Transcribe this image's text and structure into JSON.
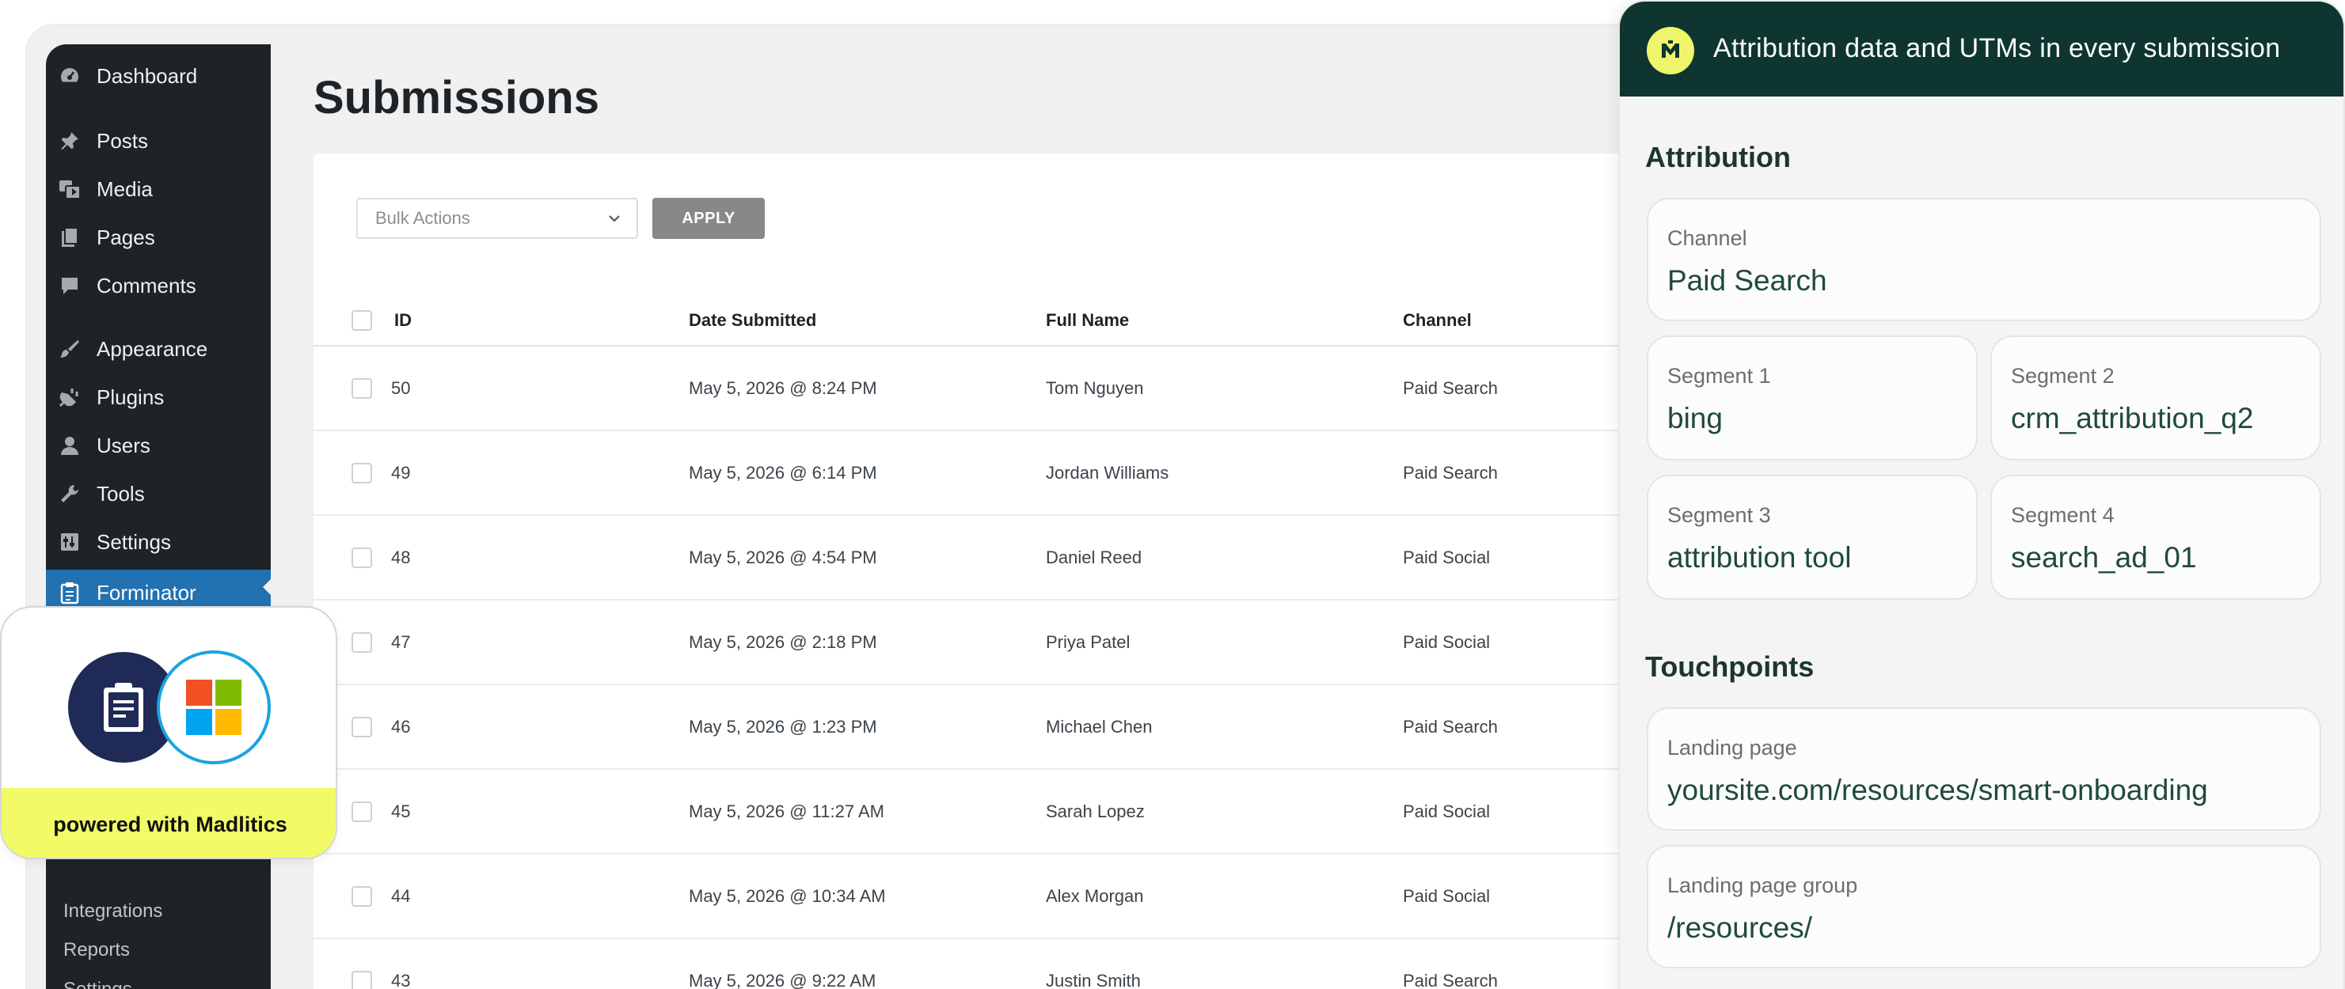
{
  "sidebar": {
    "items": [
      {
        "label": "Dashboard",
        "icon": "dashboard-icon"
      },
      {
        "label": "Posts",
        "icon": "pin-icon"
      },
      {
        "label": "Media",
        "icon": "media-icon"
      },
      {
        "label": "Pages",
        "icon": "pages-icon"
      },
      {
        "label": "Comments",
        "icon": "comment-icon"
      },
      {
        "label": "Appearance",
        "icon": "brush-icon"
      },
      {
        "label": "Plugins",
        "icon": "plug-icon"
      },
      {
        "label": "Users",
        "icon": "user-icon"
      },
      {
        "label": "Tools",
        "icon": "wrench-icon"
      },
      {
        "label": "Settings",
        "icon": "settings-icon"
      },
      {
        "label": "Forminator",
        "icon": "clipboard-icon",
        "active": true
      }
    ],
    "sub_items": [
      "Integrations",
      "Reports",
      "Settings"
    ]
  },
  "main": {
    "title": "Submissions",
    "bulk_actions_placeholder": "Bulk Actions",
    "apply_label": "APPLY",
    "columns": [
      "ID",
      "Date Submitted",
      "Full Name",
      "Channel"
    ],
    "rows": [
      {
        "id": "50",
        "date": "May 5, 2026 @ 8:24 PM",
        "name": "Tom Nguyen",
        "channel": "Paid Search"
      },
      {
        "id": "49",
        "date": "May 5, 2026 @ 6:14 PM",
        "name": "Jordan Williams",
        "channel": "Paid Search"
      },
      {
        "id": "48",
        "date": "May 5, 2026 @ 4:54 PM",
        "name": "Daniel Reed",
        "channel": "Paid Social"
      },
      {
        "id": "47",
        "date": "May 5, 2026 @ 2:18 PM",
        "name": "Priya Patel",
        "channel": "Paid Social"
      },
      {
        "id": "46",
        "date": "May 5, 2026 @ 1:23 PM",
        "name": "Michael Chen",
        "channel": "Paid Search"
      },
      {
        "id": "45",
        "date": "May 5, 2026 @ 11:27 AM",
        "name": "Sarah Lopez",
        "channel": "Paid Social"
      },
      {
        "id": "44",
        "date": "May 5, 2026 @ 10:34 AM",
        "name": "Alex Morgan",
        "channel": "Paid Social"
      },
      {
        "id": "43",
        "date": "May 5, 2026 @ 9:22 AM",
        "name": "Justin Smith",
        "channel": "Paid Search"
      }
    ]
  },
  "badge": {
    "text": "powered with Madlitics",
    "icons": [
      "forminator-icon",
      "microsoft-icon"
    ]
  },
  "panel": {
    "title": "Attribution data and UTMs in every submission",
    "attribution_heading": "Attribution",
    "channel": {
      "label": "Channel",
      "value": "Paid Search"
    },
    "segments": [
      {
        "label": "Segment 1",
        "value": "bing"
      },
      {
        "label": "Segment 2",
        "value": "crm_attribution_q2"
      },
      {
        "label": "Segment 3",
        "value": "attribution tool"
      },
      {
        "label": "Segment 4",
        "value": "search_ad_01"
      }
    ],
    "touchpoints_heading": "Touchpoints",
    "landing_page": {
      "label": "Landing page",
      "value": "yoursite.com/resources/smart-onboarding"
    },
    "landing_page_group": {
      "label": "Landing page group",
      "value": "/resources/"
    }
  },
  "colors": {
    "wp_sidebar": "#1d2327",
    "wp_active": "#2271b1",
    "panel_header": "#0f3530",
    "accent_yellow": "#f3fa68",
    "value_green": "#1f4a3c"
  }
}
